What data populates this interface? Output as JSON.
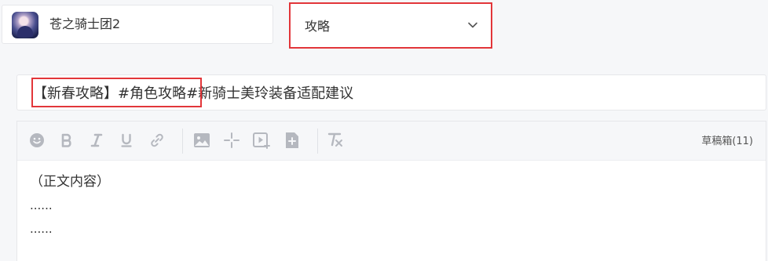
{
  "game": {
    "name": "苍之骑士团2",
    "icon": "game-cover-icon"
  },
  "category": {
    "selected": "攻略",
    "icon": "chevron-down-icon"
  },
  "title": {
    "value": "【新春攻略】#角色攻略#新骑士美玲装备适配建议"
  },
  "toolbar": {
    "buttons": [
      "emoji-icon",
      "bold-icon",
      "italic-icon",
      "underline-icon",
      "link-icon",
      "image-icon",
      "divider-insert-icon",
      "video-icon",
      "file-icon",
      "clear-format-icon"
    ],
    "drafts_label": "草稿箱(11)"
  },
  "editor": {
    "lines": [
      "（正文内容）",
      "......",
      "......"
    ]
  },
  "colors": {
    "highlight": "#e2363a",
    "icon": "#b5b8bf",
    "background": "#f6f7f9"
  }
}
